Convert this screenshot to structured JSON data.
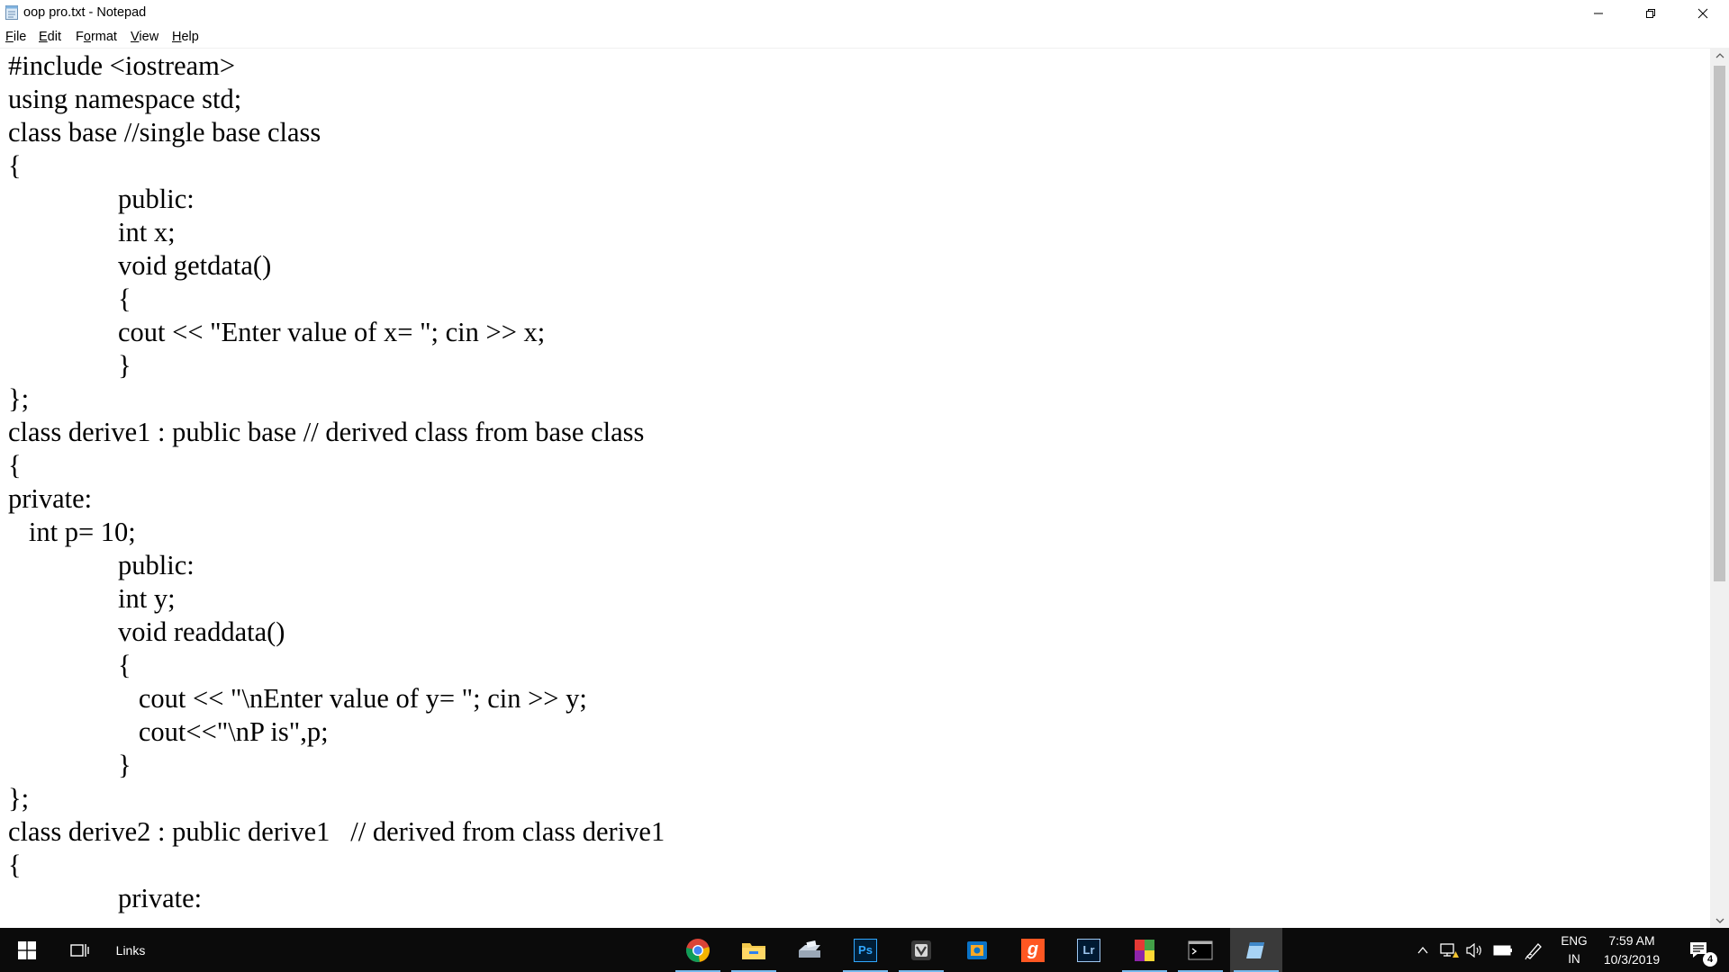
{
  "window": {
    "title": "oop pro.txt - Notepad",
    "controls": {
      "minimize": "—",
      "restore": "❐",
      "close": "✕"
    }
  },
  "menu": [
    {
      "label": "File",
      "accel": "F",
      "rest": "ile"
    },
    {
      "label": "Edit",
      "accel": "E",
      "rest": "dit"
    },
    {
      "label": "Format",
      "accel": "o",
      "pre": "F",
      "rest": "rmat"
    },
    {
      "label": "View",
      "accel": "V",
      "rest": "iew"
    },
    {
      "label": "Help",
      "accel": "H",
      "rest": "elp"
    }
  ],
  "editor": {
    "lines": [
      "#include <iostream>",
      "using namespace std;",
      "class base //single base class",
      "{",
      "                public:",
      "                int x;",
      "                void getdata()",
      "                {",
      "                cout << \"Enter value of x= \"; cin >> x;",
      "                }",
      "};",
      "class derive1 : public base // derived class from base class",
      "{",
      "private:",
      "   int p= 10;",
      "                public:",
      "                int y;",
      "                void readdata()",
      "                {",
      "                   cout << \"\\nEnter value of y= \"; cin >> y;",
      "                   cout<<\"\\nP is\",p;",
      "                }",
      "};",
      "class derive2 : public derive1   // derived from class derive1",
      "{",
      "                private:"
    ]
  },
  "taskbar": {
    "links_label": "Links",
    "apps": [
      {
        "name": "chrome-icon",
        "active": true
      },
      {
        "name": "file-explorer-icon",
        "active": true
      },
      {
        "name": "scanner-icon",
        "active": false
      },
      {
        "name": "photoshop-icon",
        "label": "Ps",
        "active": true
      },
      {
        "name": "vmware-icon",
        "active": true
      },
      {
        "name": "outlook-icon",
        "active": false
      },
      {
        "name": "g-app-icon",
        "label": "g",
        "active": false
      },
      {
        "name": "lightroom-icon",
        "label": "Lr",
        "active": false
      },
      {
        "name": "winrar-icon",
        "active": true
      },
      {
        "name": "cmd-icon",
        "active": true
      },
      {
        "name": "notepad-icon",
        "active": true
      }
    ],
    "tray": {
      "language_top": "ENG",
      "language_bottom": "IN",
      "time": "7:59 AM",
      "date": "10/3/2019",
      "notifications_count": "4"
    }
  },
  "colors": {
    "taskbar_bg": "#0b0b0b",
    "accent_indicator": "#76b9ed",
    "scrollbar_track": "#f0f0f0",
    "scrollbar_thumb": "#c2c2c2"
  }
}
